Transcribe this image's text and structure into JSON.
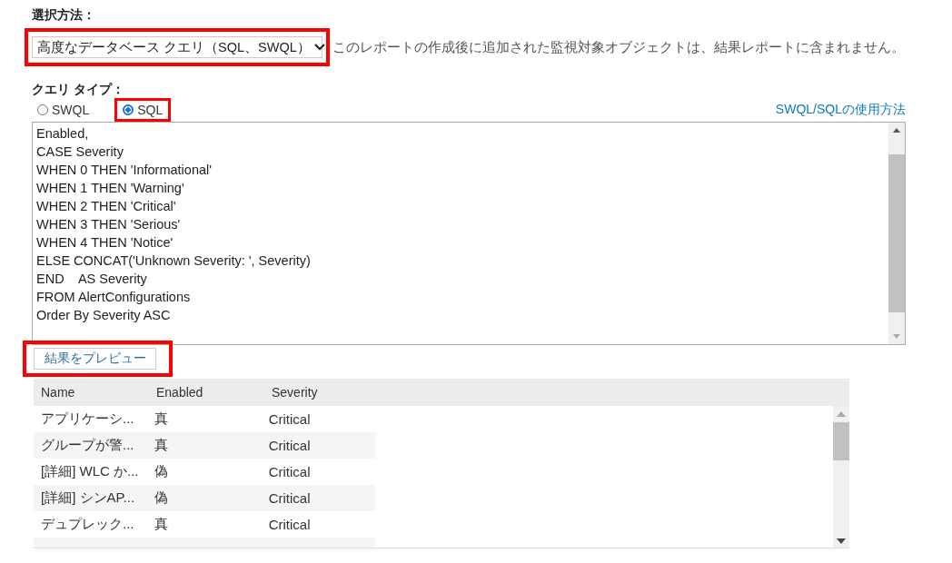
{
  "selection_method": {
    "label": "選択方法：",
    "dropdown": {
      "value": "高度なデータベース クエリ（SQL、SWQL）",
      "highlighted": true
    },
    "note": "このレポートの作成後に追加された監視対象オブジェクトは、結果レポートに含まれません。"
  },
  "query_type": {
    "label": "クエリ タイプ：",
    "options": [
      {
        "label": "SWQL",
        "selected": false,
        "highlighted": false
      },
      {
        "label": "SQL",
        "selected": true,
        "highlighted": true
      }
    ],
    "help_link": "SWQL/SQLの使用方法"
  },
  "query_editor": {
    "lines": [
      "Enabled,",
      "CASE Severity",
      "WHEN 0 THEN 'Informational'",
      "WHEN 1 THEN 'Warning'",
      "WHEN 2 THEN 'Critical'",
      "WHEN 3 THEN 'Serious'",
      "WHEN 4 THEN 'Notice'",
      "ELSE CONCAT('Unknown Severity: ', Severity)",
      "END    AS Severity",
      "FROM AlertConfigurations",
      "Order By Severity ASC"
    ]
  },
  "preview_button": {
    "label": "結果をプレビュー",
    "highlighted": true
  },
  "table": {
    "columns": [
      "Name",
      "Enabled",
      "Severity"
    ],
    "rows": [
      [
        "アプリケーシ...",
        "真",
        "Critical"
      ],
      [
        "グループが警...",
        "真",
        "Critical"
      ],
      [
        "[詳細] WLC か...",
        "偽",
        "Critical"
      ],
      [
        "[詳細] シンAP...",
        "偽",
        "Critical"
      ],
      [
        "デュプレック...",
        "真",
        "Critical"
      ]
    ]
  }
}
